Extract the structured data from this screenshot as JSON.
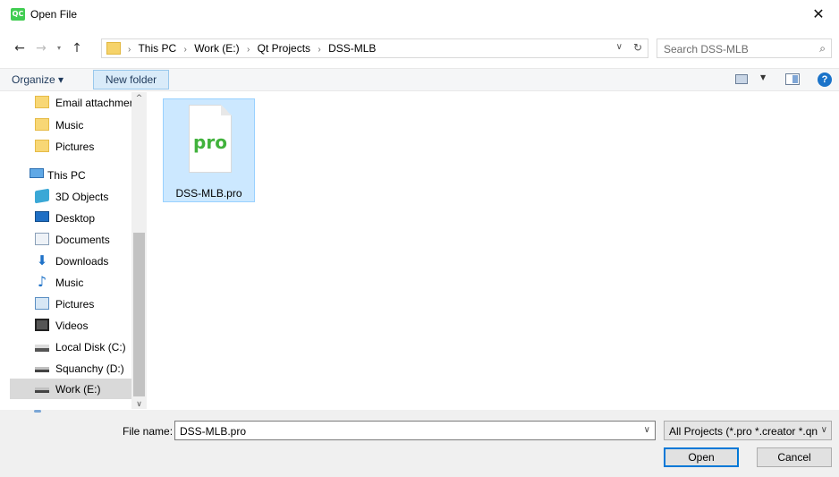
{
  "window": {
    "app_icon_text": "QC",
    "title": "Open File",
    "close_glyph": "✕"
  },
  "nav": {
    "back_glyph": "←",
    "forward_glyph": "→",
    "recent_glyph": "▾",
    "up_glyph": "↑",
    "breadcrumbs": [
      "This PC",
      "Work (E:)",
      "Qt Projects",
      "DSS-MLB"
    ],
    "crumb_separator": "›",
    "dropdown_glyph": "∨",
    "refresh_glyph": "↻",
    "search_placeholder": "Search DSS-MLB",
    "search_glyph": "⌕"
  },
  "toolbar": {
    "organize_label": "Organize ▾",
    "new_folder_label": "New folder",
    "view_dropdown_glyph": "▼",
    "help_glyph": "?"
  },
  "sidebar": {
    "items": [
      {
        "label": "Email attachmer",
        "icon": "folder-icon"
      },
      {
        "label": "Music",
        "icon": "folder-icon"
      },
      {
        "label": "Pictures",
        "icon": "folder-icon"
      },
      {
        "label": "This PC",
        "icon": "computer-icon"
      },
      {
        "label": "3D Objects",
        "icon": "3d-objects-icon"
      },
      {
        "label": "Desktop",
        "icon": "desktop-icon"
      },
      {
        "label": "Documents",
        "icon": "documents-icon"
      },
      {
        "label": "Downloads",
        "icon": "downloads-icon"
      },
      {
        "label": "Music",
        "icon": "music-icon"
      },
      {
        "label": "Pictures",
        "icon": "pictures-icon"
      },
      {
        "label": "Videos",
        "icon": "videos-icon"
      },
      {
        "label": "Local Disk (C:)",
        "icon": "local-disk-icon"
      },
      {
        "label": "Squanchy (D:)",
        "icon": "drive-icon"
      },
      {
        "label": "Work (E:)",
        "icon": "drive-icon",
        "selected": true
      }
    ],
    "scroll_up_glyph": "^",
    "scroll_down_glyph": "∨",
    "download_arrow_glyph": "⬇",
    "music_note_glyph": "♪"
  },
  "files": [
    {
      "name": "DSS-MLB.pro",
      "badge": "pro",
      "selected": true
    }
  ],
  "footer": {
    "file_name_label": "File name:",
    "file_name_value": "DSS-MLB.pro",
    "file_name_dropdown_glyph": "∨",
    "filter_value": "All Projects (*.pro *.creator *.qn",
    "filter_dropdown_glyph": "∨",
    "open_label": "Open",
    "cancel_label": "Cancel"
  }
}
